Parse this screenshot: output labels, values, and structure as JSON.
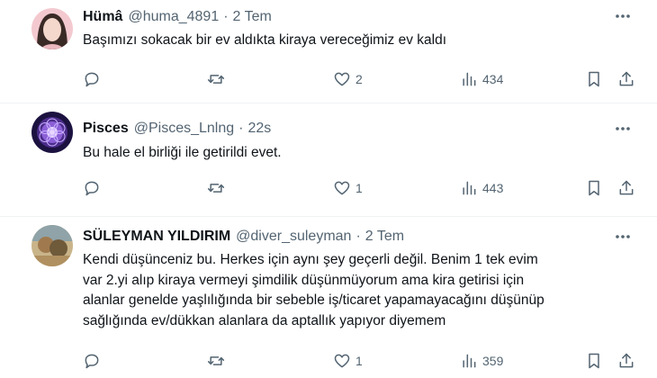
{
  "tweets": [
    {
      "name": "Hümâ",
      "handle": "@huma_4891",
      "separator": "·",
      "time": "2 Tem",
      "text": "Başımızı sokacak bir ev aldıkta kiraya vereceğimiz ev kaldı",
      "likes": "2",
      "views": "434"
    },
    {
      "name": "Pisces",
      "handle": "@Pisces_Lnlng",
      "separator": "·",
      "time": "22s",
      "text": "Bu hale el birliği ile getirildi evet.",
      "likes": "1",
      "views": "443"
    },
    {
      "name": "SÜLEYMAN YILDIRIM",
      "handle": "@diver_suleyman",
      "separator": "·",
      "time": "2 Tem",
      "text_lines": [
        "Kendi düşünceniz bu. Herkes için aynı şey geçerli değil. Benim 1 tek evim",
        "var 2.yi alıp kiraya vermeyi şimdilik düşünmüyorum ama kira getirisi için",
        "alanlar genelde yaşlılığında bir sebeble iş/ticaret yapamayacağını düşünüp",
        "sağlığında ev/dükkan alanlara da aptallık yapıyor diyemem"
      ],
      "likes": "1",
      "views": "359"
    }
  ],
  "icons": [
    "more-icon",
    "reply-icon",
    "retweet-icon",
    "like-icon",
    "views-icon",
    "bookmark-icon",
    "share-icon"
  ],
  "colors": {
    "text": "#0f1419",
    "secondary": "#536471",
    "divider": "#eff3f4"
  }
}
